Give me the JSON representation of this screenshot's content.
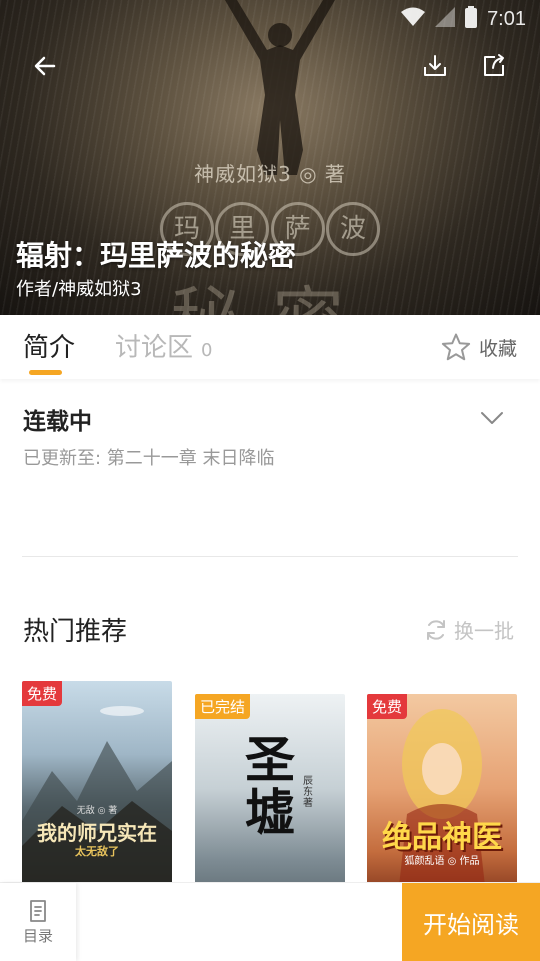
{
  "status_bar": {
    "time": "7:01"
  },
  "hero": {
    "cover_author": "神威如狱3 ◎ 著",
    "cover_chars": [
      "玛",
      "里",
      "萨",
      "波"
    ],
    "cover_big": "秘密",
    "title": "辐射：玛里萨波的秘密",
    "author": "作者/神威如狱3"
  },
  "tabs": {
    "intro": "简介",
    "discuss": "讨论区",
    "discuss_count": "0",
    "collect": "收藏"
  },
  "detail": {
    "status": "连载中",
    "latest": "已更新至: 第二十一章 末日降临"
  },
  "recommend": {
    "title": "热门推荐",
    "refresh": "换一批",
    "books": [
      {
        "badge": "免费",
        "cover_line1": "我的师兄实在",
        "cover_line2": "太无敌了",
        "cover_small": "无敌 ◎ 著"
      },
      {
        "badge": "已完结",
        "cover_line1": "圣墟",
        "cover_small": "辰东 著"
      },
      {
        "badge": "免费",
        "cover_line1": "绝品神医",
        "cover_small": "狐颜乱语 ◎ 作品"
      }
    ]
  },
  "bottom": {
    "toc": "目录",
    "read": "开始阅读"
  },
  "colors": {
    "accent": "#f5a623",
    "badge_red": "#e4393c"
  }
}
